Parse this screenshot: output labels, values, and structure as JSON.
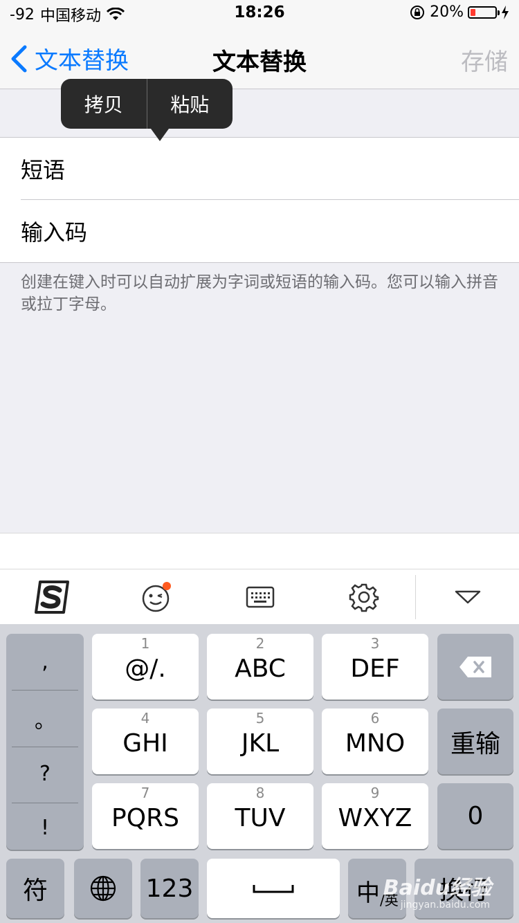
{
  "status": {
    "signal": "-92",
    "carrier": "中国移动",
    "time": "18:26",
    "battery_text": "20%",
    "battery_level": 0.2,
    "battery_color": "#ff3b30"
  },
  "nav": {
    "back_label": "文本替换",
    "title": "文本替换",
    "save_label": "存储",
    "accent": "#0a7aff"
  },
  "popup": {
    "copy_label": "拷贝",
    "paste_label": "粘贴"
  },
  "form": {
    "phrase_label": "短语",
    "shortcut_label": "输入码",
    "hint": "创建在键入时可以自动扩展为字词或短语的输入码。您可以输入拼音或拉丁字母。"
  },
  "toolbar": {
    "icons": [
      "sogou-logo-icon",
      "emoji-icon",
      "keyboard-icon",
      "settings-gear-icon",
      "hide-keyboard-icon"
    ]
  },
  "keyboard": {
    "punct": [
      ",",
      "。",
      "?",
      "!"
    ],
    "keys": [
      {
        "num": "1",
        "label": "@/."
      },
      {
        "num": "2",
        "label": "ABC"
      },
      {
        "num": "3",
        "label": "DEF"
      },
      {
        "num": "4",
        "label": "GHI"
      },
      {
        "num": "5",
        "label": "JKL"
      },
      {
        "num": "6",
        "label": "MNO"
      },
      {
        "num": "7",
        "label": "PQRS"
      },
      {
        "num": "8",
        "label": "TUV"
      },
      {
        "num": "9",
        "label": "WXYZ"
      }
    ],
    "reenter_label": "重输",
    "zero_label": "0",
    "symbols_label": "符",
    "numbers_label": "123",
    "lang_label": "中",
    "lang_sub": "/英",
    "return_label": "换行"
  },
  "watermark": {
    "brand": "Baidu经验",
    "url": "jingyan.baidu.com"
  }
}
